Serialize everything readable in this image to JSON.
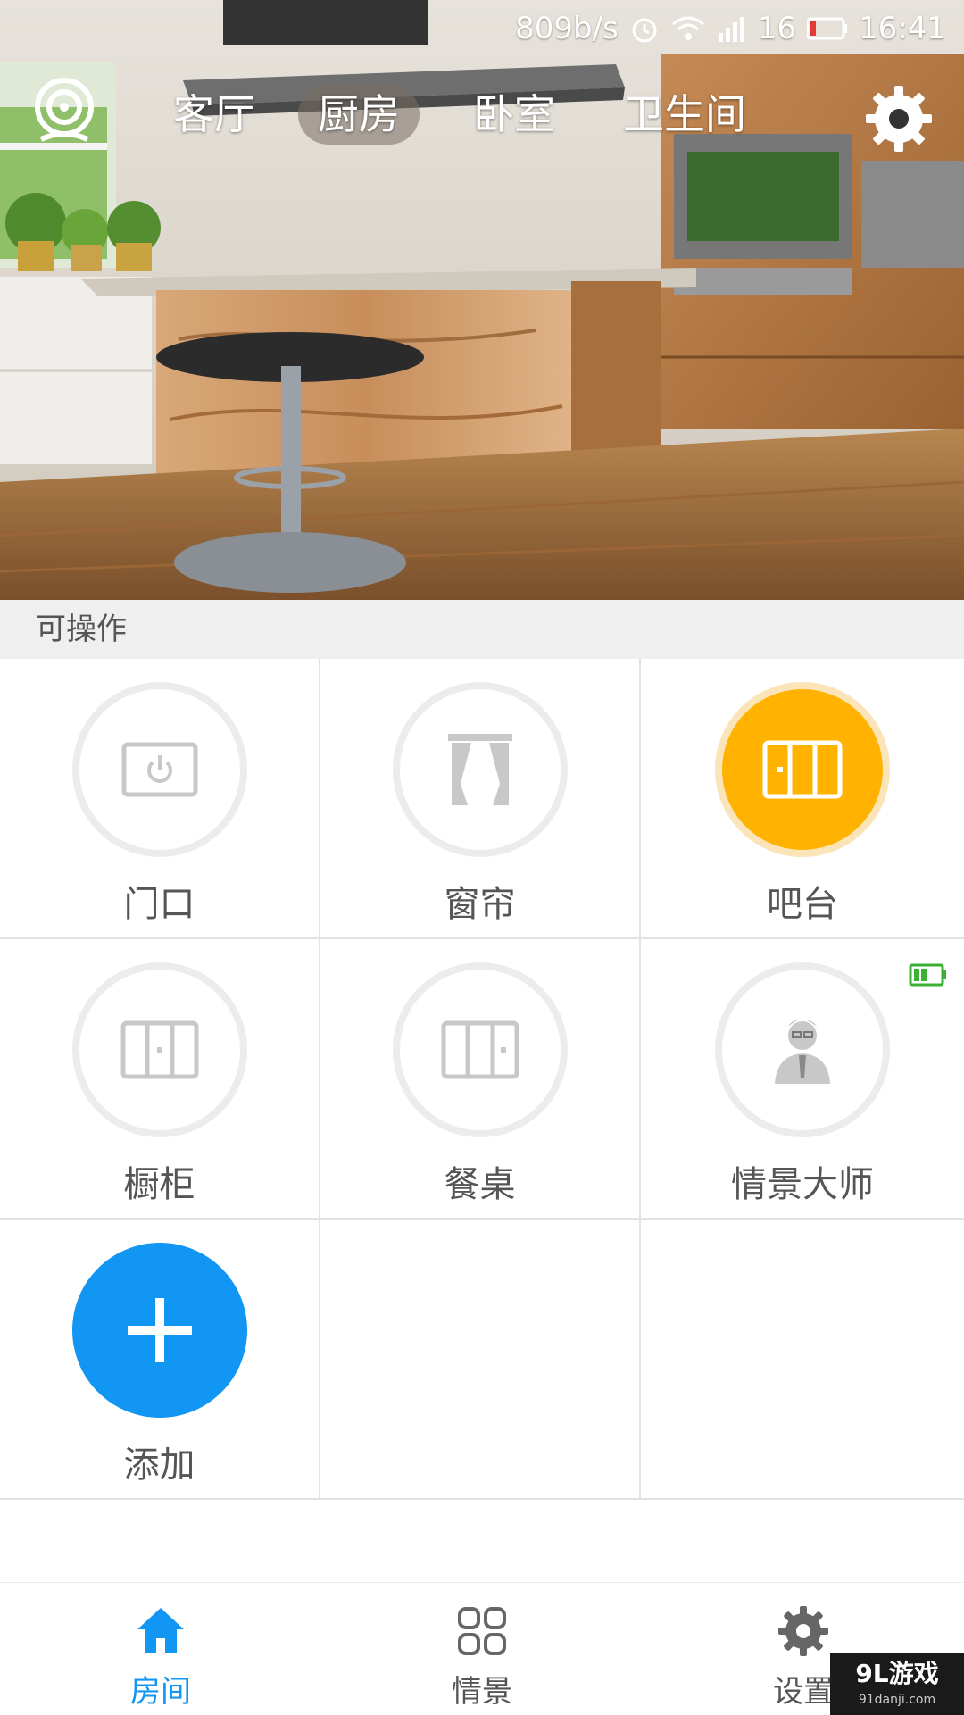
{
  "status_bar": {
    "speed": "809b/s",
    "signal": "16",
    "time": "16:41"
  },
  "rooms": [
    {
      "label": "客厅"
    },
    {
      "label": "厨房"
    },
    {
      "label": "卧室"
    },
    {
      "label": "卫生间"
    }
  ],
  "active_room": "厨房",
  "section_title": "可操作",
  "devices": [
    {
      "label": "门口",
      "icon": "power-switch-icon",
      "state": "off"
    },
    {
      "label": "窗帘",
      "icon": "curtain-icon",
      "state": "off"
    },
    {
      "label": "吧台",
      "icon": "three-panel-switch-icon",
      "state": "on"
    },
    {
      "label": "橱柜",
      "icon": "two-panel-switch-icon",
      "state": "off"
    },
    {
      "label": "餐桌",
      "icon": "two-panel-switch-icon",
      "state": "off"
    },
    {
      "label": "情景大师",
      "icon": "scene-master-icon",
      "state": "off",
      "battery": "green"
    }
  ],
  "add_label": "添加",
  "bottom_nav": [
    {
      "label": "房间",
      "icon": "home-icon",
      "active": true
    },
    {
      "label": "情景",
      "icon": "grid-four-icon",
      "active": false
    },
    {
      "label": "设置",
      "icon": "gear-icon",
      "active": false
    }
  ],
  "watermark": {
    "main": "9L游戏",
    "sub": "91danji.com"
  },
  "colors": {
    "accent": "#1296f3",
    "on_state": "#ffb300",
    "battery": "#3cb034"
  }
}
